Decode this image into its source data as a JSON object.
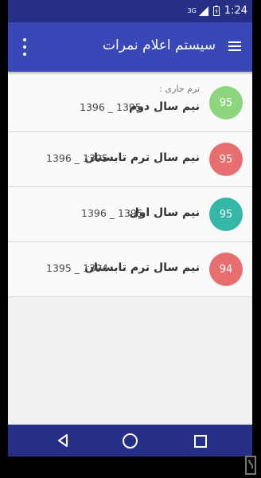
{
  "status": {
    "network": "3G",
    "time": "1:24"
  },
  "appbar": {
    "title": "سیستم اعلام نمرات"
  },
  "terms": [
    {
      "current_label": "ترم جاری :",
      "name": "نیم سال دوم",
      "years": "1396 _ 1395",
      "score": "95",
      "color": "#8ed67e"
    },
    {
      "name": "نیم سال ترم تابستان",
      "years": "1396 _ 1395",
      "score": "95",
      "color": "#e86f6f"
    },
    {
      "name": "نیم سال اول",
      "years": "1396 _ 1395",
      "score": "95",
      "color": "#34b7a7"
    },
    {
      "name": "نیم سال ترم تابستان",
      "years": "1395 _ 1394",
      "score": "94",
      "color": "#e86f6f"
    }
  ]
}
